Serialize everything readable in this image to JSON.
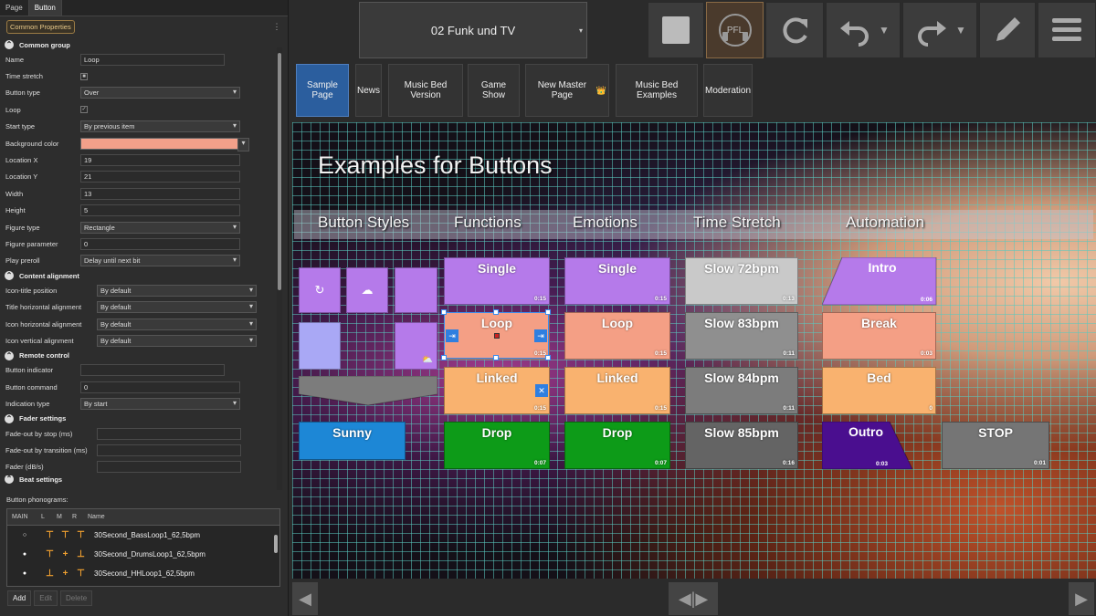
{
  "left_panel": {
    "tabs": [
      "Page",
      "Button"
    ],
    "common_properties_label": "Common Properties",
    "more_icon": "⋮",
    "sections": {
      "common_group": "Common group",
      "content_alignment": "Content alignment",
      "remote_control": "Remote control",
      "fader_settings": "Fader settings",
      "beat_settings": "Beat settings"
    },
    "props": {
      "name": {
        "label": "Name",
        "value": "Loop"
      },
      "time_stretch": {
        "label": "Time stretch",
        "value": "■"
      },
      "button_type": {
        "label": "Button type",
        "value": "Over"
      },
      "loop": {
        "label": "Loop",
        "value": "✓"
      },
      "start_type": {
        "label": "Start type",
        "value": "By previous item"
      },
      "background_color": {
        "label": "Background color",
        "value": "#f2a08a"
      },
      "location_x": {
        "label": "Location X",
        "value": "19"
      },
      "location_y": {
        "label": "Location Y",
        "value": "21"
      },
      "width": {
        "label": "Width",
        "value": "13"
      },
      "height": {
        "label": "Height",
        "value": "5"
      },
      "figure_type": {
        "label": "Figure type",
        "value": "Rectangle"
      },
      "figure_parameter": {
        "label": "Figure parameter",
        "value": "0"
      },
      "play_preroll": {
        "label": "Play preroll",
        "value": "Delay until next bit"
      },
      "icon_title_position": {
        "label": "Icon-title position",
        "value": "By default"
      },
      "title_h_align": {
        "label": "Title horizontal alignment",
        "value": "By default"
      },
      "icon_h_align": {
        "label": "Icon horizontal alignment",
        "value": "By default"
      },
      "icon_v_align": {
        "label": "Icon vertical alignment",
        "value": "By default"
      },
      "button_indicator": {
        "label": "Button indicator",
        "value": ""
      },
      "button_command": {
        "label": "Button command",
        "value": "0"
      },
      "indication_type": {
        "label": "Indication type",
        "value": "By start"
      },
      "fadeout_stop": {
        "label": "Fade-out by stop (ms)",
        "value": ""
      },
      "fadeout_transition": {
        "label": "Fade-out by transition (ms)",
        "value": ""
      },
      "fader": {
        "label": "Fader (dB/s)",
        "value": ""
      }
    },
    "phonograms_label": "Button phonograms:",
    "phonogram_columns": [
      "MAIN",
      "L",
      "M",
      "R",
      "Name"
    ],
    "phonograms": [
      {
        "main": "○",
        "l": "⊤",
        "m": "⊤",
        "r": "⊤",
        "name": "30Second_BassLoop1_62,5bpm"
      },
      {
        "main": "●",
        "l": "⊤",
        "m": "+",
        "r": "⊥",
        "name": "30Second_DrumsLoop1_62,5bpm"
      },
      {
        "main": "●",
        "l": "⊥",
        "m": "+",
        "r": "⊤",
        "name": "30Second_HHLoop1_62,5bpm"
      }
    ],
    "buttons": {
      "add": "Add",
      "edit": "Edit",
      "delete": "Delete"
    }
  },
  "top_bar": {
    "page_select": "02 Funk und TV",
    "pfl_label": "PFL",
    "icons": [
      "stop-icon",
      "pfl-headphones-icon",
      "reload-icon",
      "undo-icon",
      "redo-icon",
      "edit-icon",
      "menu-icon"
    ]
  },
  "page_tabs": [
    "Sample Page",
    "News",
    "Music Bed Version",
    "Game Show",
    "New Master Page",
    "Music Bed Examples",
    "Moderation"
  ],
  "page_tab_crown": "👑",
  "canvas": {
    "title": "Examples for Buttons",
    "headers": [
      "Button Styles",
      "Functions",
      "Emotions",
      "Time Stretch",
      "Automation"
    ],
    "buttons": {
      "sunny": {
        "label": "Sunny",
        "color": "#1d87d6"
      },
      "f_single": {
        "label": "Single",
        "time": "0:15",
        "color": "#b57aea"
      },
      "f_loop": {
        "label": "Loop",
        "time": "0:15",
        "color": "#f49f85"
      },
      "f_linked": {
        "label": "Linked",
        "time": "0:15",
        "color": "#f9b26f"
      },
      "f_drop": {
        "label": "Drop",
        "time": "0:07",
        "color": "#0d9b18"
      },
      "e_single": {
        "label": "Single",
        "time": "0:15",
        "color": "#b57aea"
      },
      "e_loop": {
        "label": "Loop",
        "time": "0:15",
        "color": "#f49f85"
      },
      "e_linked": {
        "label": "Linked",
        "time": "0:15",
        "color": "#f9b26f"
      },
      "e_drop": {
        "label": "Drop",
        "time": "0:07",
        "color": "#0d9b18"
      },
      "ts1": {
        "label": "Slow 72bpm",
        "time": "0:13",
        "color": "#c9c9c9"
      },
      "ts2": {
        "label": "Slow 83bpm",
        "time": "0:11",
        "color": "#8f8f8f"
      },
      "ts3": {
        "label": "Slow 84bpm",
        "time": "0:11",
        "color": "#7c7c7c"
      },
      "ts4": {
        "label": "Slow 85bpm",
        "time": "0:16",
        "color": "#646464"
      },
      "intro": {
        "label": "Intro",
        "time": "0:06",
        "color": "#b57aea"
      },
      "break": {
        "label": "Break",
        "time": "0:03",
        "color": "#f49f85"
      },
      "bed": {
        "label": "Bed",
        "time": "0",
        "color": "#f9b26f"
      },
      "outro": {
        "label": "Outro",
        "time": "0:03",
        "color": "#4a0e8f"
      },
      "stop": {
        "label": "STOP",
        "time": "0:01",
        "color": "#757575"
      }
    }
  }
}
